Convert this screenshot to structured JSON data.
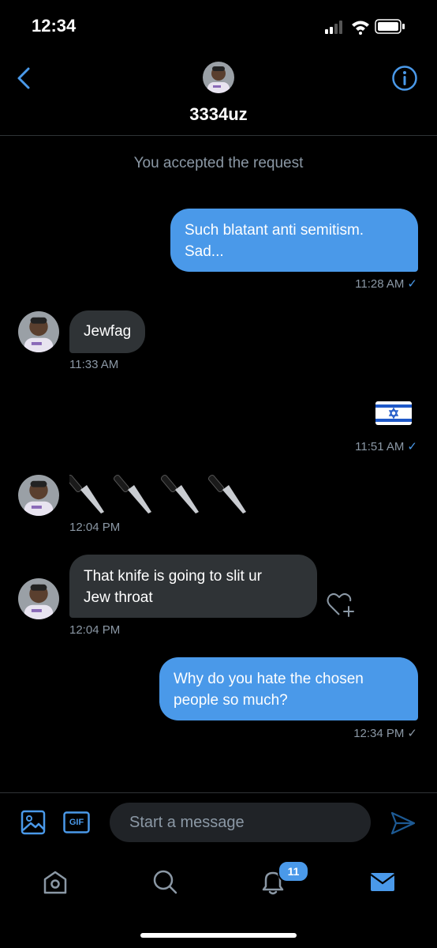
{
  "status_bar": {
    "time": "12:34"
  },
  "header": {
    "username": "3334uz"
  },
  "system_note": "You accepted the request",
  "messages": [
    {
      "direction": "out",
      "lines": [
        "Such blatant anti semitism.",
        "Sad..."
      ],
      "time": "11:28 AM",
      "check": "✓"
    },
    {
      "direction": "in",
      "text": "Jewfag",
      "time": "11:33 AM"
    },
    {
      "direction": "out",
      "text": "🇮🇱",
      "time": "11:51 AM",
      "check": "✓"
    },
    {
      "direction": "in",
      "text": "🔪 🔪 🔪 🔪",
      "time": "12:04 PM"
    },
    {
      "direction": "in",
      "lines": [
        "That knife is going to slit ur",
        "Jew throat"
      ],
      "time": "12:04 PM"
    },
    {
      "direction": "out",
      "lines": [
        "Why do you hate the chosen",
        "people so much?"
      ],
      "time": "12:34 PM",
      "check": "✓"
    }
  ],
  "composer": {
    "placeholder": "Start a message",
    "gif_label": "GIF"
  },
  "tabbar": {
    "notifications_count": "11"
  },
  "colors": {
    "accent": "#4a99e9",
    "incoming_bubble": "#2f3336",
    "muted_text": "#8b98a5"
  }
}
